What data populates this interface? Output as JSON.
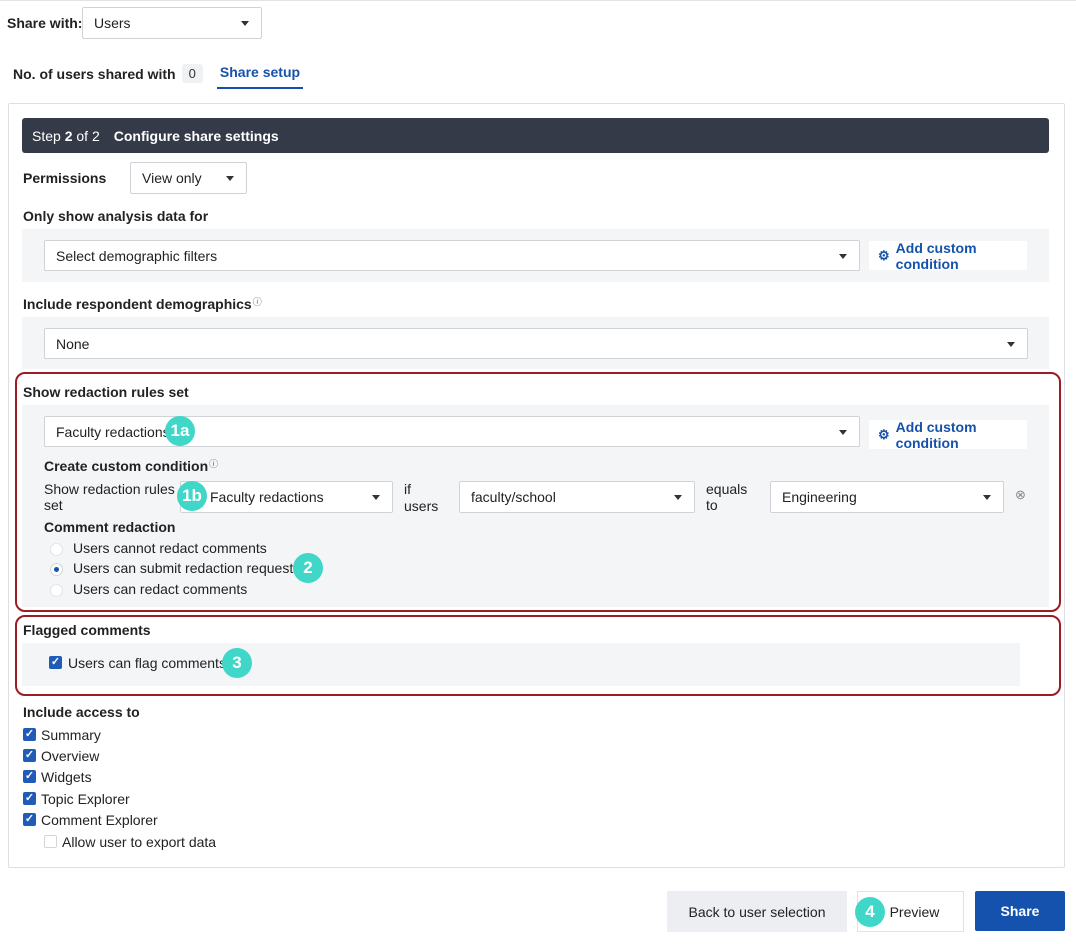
{
  "share_with": {
    "label": "Share with:",
    "value": "Users"
  },
  "tabs": {
    "users_label": "No. of users shared with",
    "users_count": "0",
    "setup_label": "Share setup"
  },
  "step": {
    "prefix": "Step",
    "current": "2",
    "of": "of",
    "total": "2",
    "title": "Configure share settings"
  },
  "permissions": {
    "label": "Permissions",
    "value": "View only"
  },
  "analysis": {
    "label": "Only show analysis data for",
    "placeholder": "Select demographic filters",
    "add_condition": "Add custom condition"
  },
  "demographics": {
    "label": "Include respondent demographics",
    "value": "None"
  },
  "redaction": {
    "label": "Show redaction rules set",
    "value": "Faculty redactions",
    "add_condition": "Add custom condition",
    "custom_label": "Create custom condition",
    "rule_label_line1": "Show redaction rules",
    "rule_label_line2": "set",
    "rule_value": "Faculty redactions",
    "if_line1": "if",
    "if_line2": "users",
    "field_value": "faculty/school",
    "equals_line1": "equals",
    "equals_line2": "to",
    "equals_value": "Engineering",
    "comment_label": "Comment redaction",
    "options": [
      "Users cannot redact comments",
      "Users can submit redaction requests",
      "Users can redact comments"
    ],
    "selected_index": 1
  },
  "flagged": {
    "label": "Flagged comments",
    "option": "Users can flag comments",
    "checked": true
  },
  "access": {
    "label": "Include access to",
    "items": [
      "Summary",
      "Overview",
      "Widgets",
      "Topic Explorer",
      "Comment Explorer"
    ],
    "export_label": "Allow user to export data"
  },
  "badges": {
    "b1a": "1a",
    "b1b": "1b",
    "b2": "2",
    "b3": "3",
    "b4": "4"
  },
  "buttons": {
    "back": "Back to user selection",
    "preview": "Preview",
    "share": "Share"
  },
  "colors": {
    "accent": "#1552ad",
    "badge": "#40d7c9",
    "highlight_border": "#9b1c22",
    "stepbar": "#343a48"
  }
}
